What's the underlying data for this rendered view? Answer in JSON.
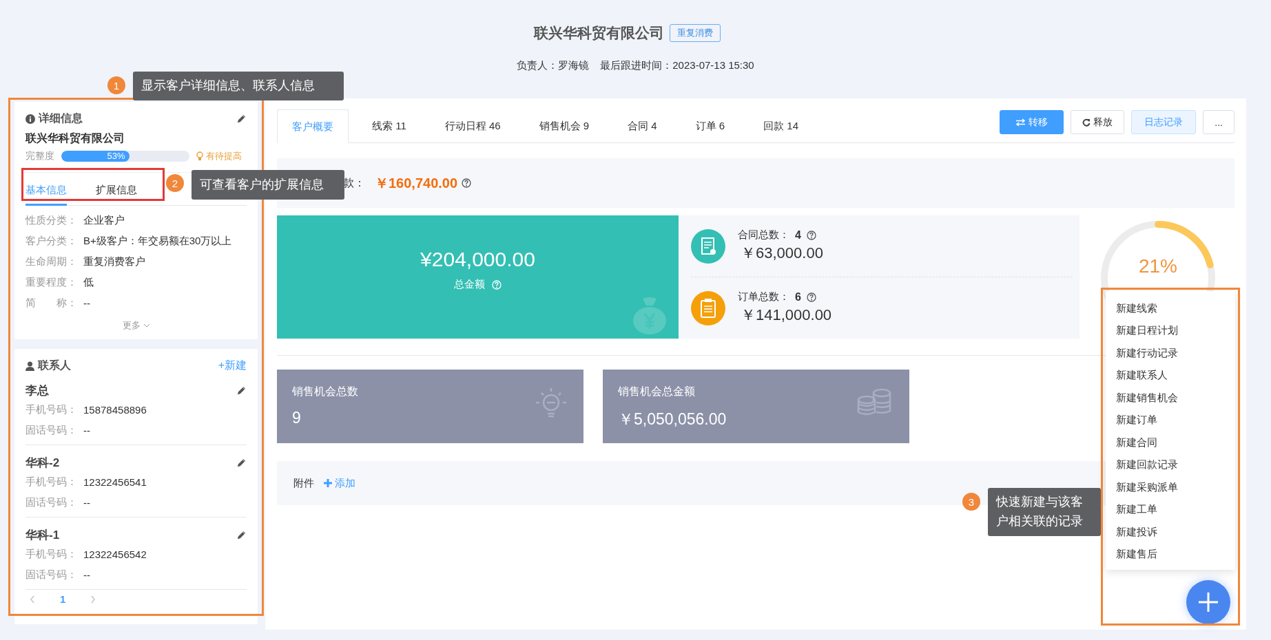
{
  "header": {
    "title": "联兴华科贸有限公司",
    "badge": "重复消费",
    "owner": "负责人：罗海镜",
    "last_follow": "最后跟进时间：2023-07-13 15:30"
  },
  "detail_card": {
    "title": "详细信息",
    "company": "联兴华科贸有限公司",
    "completeness_label": "完整度",
    "completeness": {
      "level": 0.53,
      "reading": "53%"
    },
    "hint": "有待提高",
    "tabs": [
      {
        "label": "基本信息",
        "selected": true
      },
      {
        "label": "扩展信息",
        "selected": false
      }
    ],
    "fields": [
      {
        "label": "性质分类：",
        "value": "企业客户"
      },
      {
        "label": "客户分类：",
        "value": "B+级客户：年交易额在30万以上"
      },
      {
        "label": "生命周期：",
        "value": "重复消费客户"
      },
      {
        "label": "重要程度：",
        "value": "低"
      },
      {
        "label": "简　　称：",
        "value": "--"
      }
    ],
    "more": "更多"
  },
  "contacts_card": {
    "title": "联系人",
    "new_link": "+新建",
    "contacts": [
      {
        "name": "李总",
        "fields": [
          {
            "label": "手机号码：",
            "value": "15878458896"
          },
          {
            "label": "固话号码：",
            "value": "--"
          }
        ]
      },
      {
        "name": "华科-2",
        "fields": [
          {
            "label": "手机号码：",
            "value": "12322456541"
          },
          {
            "label": "固话号码：",
            "value": "--"
          }
        ]
      },
      {
        "name": "华科-1",
        "fields": [
          {
            "label": "手机号码：",
            "value": "12322456542"
          },
          {
            "label": "固话号码：",
            "value": "--"
          }
        ]
      }
    ],
    "pages": [
      {
        "label": "1",
        "selected": true
      }
    ]
  },
  "tabs": [
    {
      "label": "客户概要",
      "selected": true
    },
    {
      "label": "线索 11",
      "selected": false
    },
    {
      "label": "行动日程 46",
      "selected": false
    },
    {
      "label": "销售机会 9",
      "selected": false
    },
    {
      "label": "合同 4",
      "selected": false
    },
    {
      "label": "订单 6",
      "selected": false
    },
    {
      "label": "回款 14",
      "selected": false
    }
  ],
  "actions": [
    {
      "label": "转移",
      "kind": "transfer"
    },
    {
      "label": "释放",
      "kind": "release"
    },
    {
      "label": "日志记录",
      "kind": "log"
    },
    {
      "label": "...",
      "kind": "more"
    }
  ],
  "received": {
    "label": "款：",
    "amount": "￥160,740.00"
  },
  "total": {
    "amount": "¥204,000.00",
    "label": "总金额"
  },
  "stats": [
    {
      "kind": "contract",
      "label": "合同总数：",
      "count": "4",
      "amount": "￥63,000.00"
    },
    {
      "kind": "order",
      "label": "订单总数：",
      "count": "6",
      "amount": "￥141,000.00"
    }
  ],
  "gauge": {
    "level": 0.21,
    "reading": "21%"
  },
  "opportunity_cards": [
    {
      "kind": "bulb",
      "label": "销售机会总数",
      "value": "9"
    },
    {
      "kind": "coins",
      "label": "销售机会总金额",
      "value": "￥5,050,056.00"
    }
  ],
  "attachments": {
    "label": "附件",
    "add": "添加"
  },
  "quick_menu": [
    "新建线索",
    "新建日程计划",
    "新建行动记录",
    "新建联系人",
    "新建销售机会",
    "新建订单",
    "新建合同",
    "新建回款记录",
    "新建采购派单",
    "新建工单",
    "新建投诉",
    "新建售后"
  ],
  "annotations": [
    {
      "number": "1",
      "text": "显示客户详细信息、联系人信息"
    },
    {
      "number": "2",
      "text": "可查看客户的扩展信息"
    },
    {
      "number": "3",
      "text": "快速新建与该客户相关联的记录"
    }
  ]
}
